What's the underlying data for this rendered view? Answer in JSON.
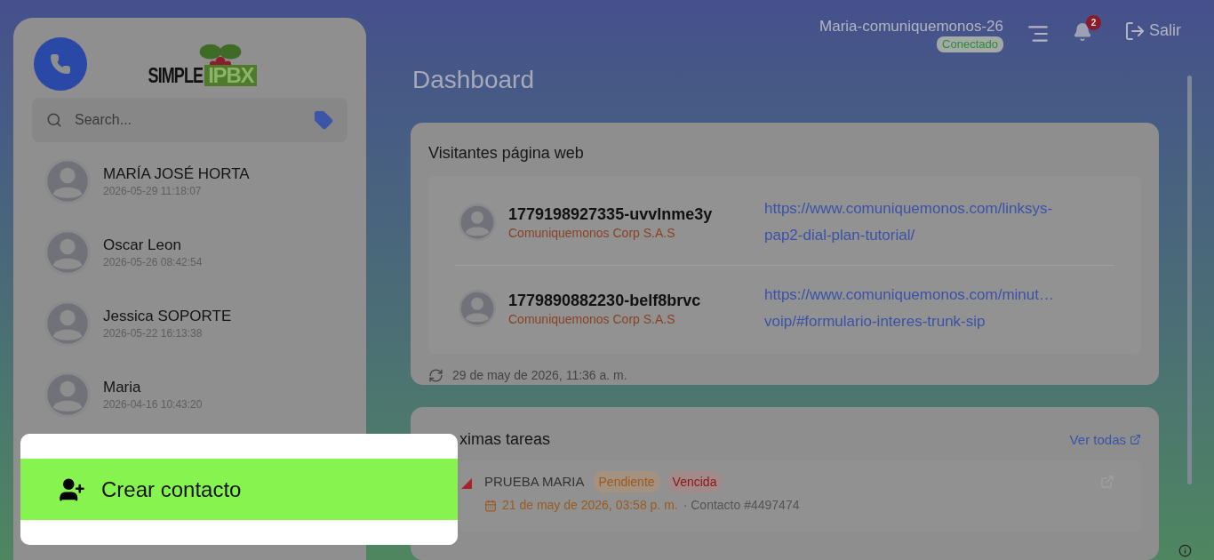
{
  "sidebar": {
    "logo": {
      "word_1": "SIMPLE",
      "word_2": "IPBX"
    },
    "search": {
      "placeholder": "Search..."
    },
    "contacts": [
      {
        "name": "MARÍA JOSÉ HORTA",
        "time": "2026-05-29 11:18:07"
      },
      {
        "name": "Oscar Leon",
        "time": "2026-05-26 08:42:54"
      },
      {
        "name": "Jessica SOPORTE",
        "time": "2026-05-22 16:13:38"
      },
      {
        "name": "Maria",
        "time": "2026-04-16 10:43:20"
      }
    ],
    "create_button": "Crear contacto"
  },
  "header": {
    "user": "Maria-comuniquemonos-26",
    "status": "Conectado",
    "notifications": "2",
    "logout": "Salir"
  },
  "page_title": "Dashboard",
  "visitors": {
    "title": "Visitantes página web",
    "items": [
      {
        "id": "1779198927335-uvvlnme3y",
        "company": "Comuniquemonos Corp S.A.S",
        "url_lines": [
          "https://www.comuniquemonos.com/linksys-",
          "pap2-dial-plan-tutorial/"
        ]
      },
      {
        "id": "1779890882230-belf8brvc",
        "company": "Comuniquemonos Corp S.A.S",
        "url_lines": [
          "https://www.comuniquemonos.com/minut…",
          "voip/#formulario-interes-trunk-sip"
        ]
      }
    ],
    "updated": "29 de may de 2026, 11:36 a. m."
  },
  "tasks": {
    "title": "ximas tareas",
    "see_all": "Ver todas",
    "items": [
      {
        "title": "PRUEBA MARIA",
        "badges": [
          {
            "label": "Pendiente",
            "kind": "pending"
          },
          {
            "label": "Vencida",
            "kind": "overdue"
          }
        ],
        "date": "21 de may de 2026, 03:58 p. m.",
        "contact": "· Contacto #4497474"
      }
    ]
  }
}
